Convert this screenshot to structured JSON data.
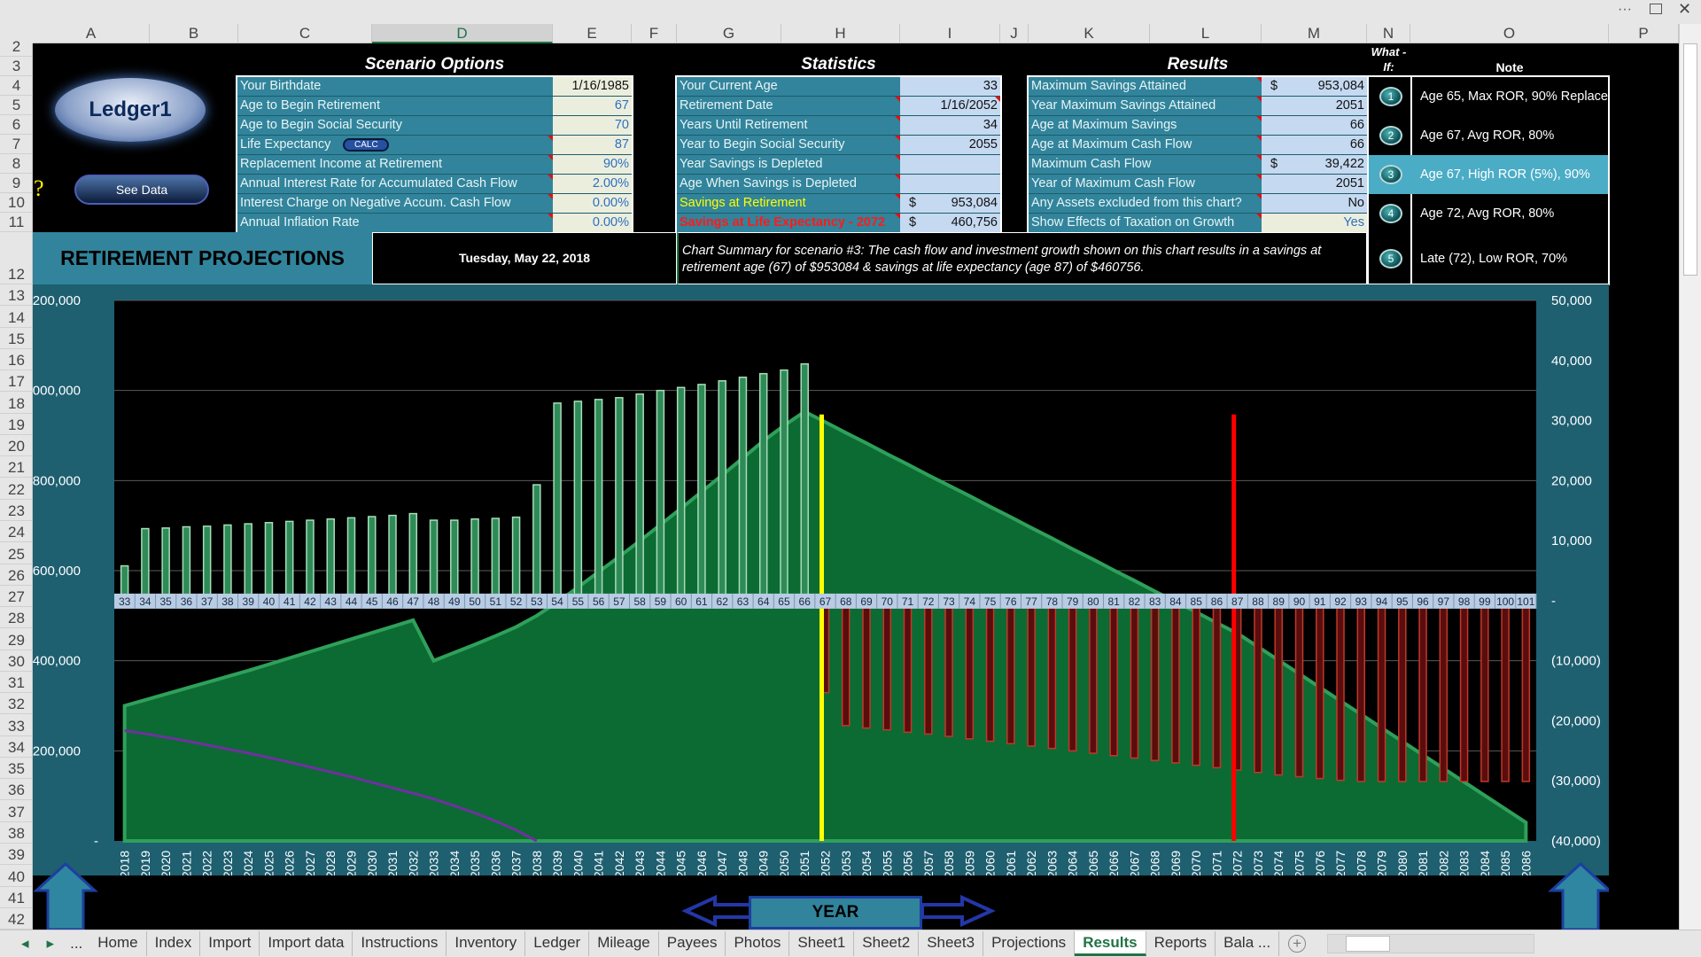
{
  "window": {
    "more_label": "···",
    "restore_icon": "restore-icon",
    "close_icon": "close-icon"
  },
  "columns": [
    "A",
    "B",
    "C",
    "D",
    "E",
    "F",
    "G",
    "H",
    "I",
    "J",
    "K",
    "L",
    "M",
    "N",
    "O",
    "P"
  ],
  "selected_column": "D",
  "rows": [
    "2",
    "3",
    "4",
    "5",
    "6",
    "7",
    "8",
    "9",
    "10",
    "11",
    "12",
    "13",
    "14",
    "15",
    "16",
    "17",
    "18",
    "19",
    "20",
    "21",
    "22",
    "23",
    "24",
    "25",
    "26",
    "27",
    "28",
    "29",
    "30",
    "31",
    "32",
    "33",
    "34",
    "35",
    "36",
    "37",
    "38",
    "39",
    "40",
    "41",
    "42"
  ],
  "logo": {
    "label": "Ledger1"
  },
  "see_data_button": "See Data",
  "help_icon": "?",
  "scenario": {
    "title": "Scenario Options",
    "calc_button": "CALC",
    "items": [
      {
        "label": "Your Birthdate",
        "value": "1/16/1985"
      },
      {
        "label": "Age to Begin Retirement",
        "value": "67"
      },
      {
        "label": "Age to Begin Social Security",
        "value": "70"
      },
      {
        "label": "Life Expectancy",
        "value": "87"
      },
      {
        "label": "Replacement Income at Retirement",
        "value": "90%"
      },
      {
        "label": "Annual Interest Rate for Accumulated Cash Flow",
        "value": "2.00%"
      },
      {
        "label": "Interest Charge on Negative Accum. Cash Flow",
        "value": "0.00%"
      },
      {
        "label": "Annual Inflation Rate",
        "value": "0.00%"
      }
    ]
  },
  "statistics": {
    "title": "Statistics",
    "items": [
      {
        "label": "Your Current Age",
        "currency": "",
        "value": "33"
      },
      {
        "label": "Retirement Date",
        "currency": "",
        "value": "1/16/2052"
      },
      {
        "label": "Years Until Retirement",
        "currency": "",
        "value": "34"
      },
      {
        "label": "Year to Begin Social Security",
        "currency": "",
        "value": "2055"
      },
      {
        "label": "Year Savings is Depleted",
        "currency": "",
        "value": ""
      },
      {
        "label": "Age When Savings is Depleted",
        "currency": "",
        "value": ""
      },
      {
        "label": "Savings at Retirement",
        "currency": "$",
        "value": "953,084",
        "color": "#ffff00"
      },
      {
        "label": "Savings at Life Expectancy - 2072",
        "currency": "$",
        "value": "460,756",
        "color": "#ff1a1a"
      }
    ]
  },
  "results": {
    "title": "Results",
    "items": [
      {
        "label": "Maximum Savings Attained",
        "currency": "$",
        "value": "953,084"
      },
      {
        "label": "Year Maximum Savings Attained",
        "currency": "",
        "value": "2051"
      },
      {
        "label": "Age at Maximum Savings",
        "currency": "",
        "value": "66"
      },
      {
        "label": "Age at Maximum Cash Flow",
        "currency": "",
        "value": "66"
      },
      {
        "label": "Maximum Cash Flow",
        "currency": "$",
        "value": "39,422"
      },
      {
        "label": "Year of Maximum Cash Flow",
        "currency": "",
        "value": "2051"
      },
      {
        "label": "Any Assets excluded from this chart?",
        "currency": "",
        "value": "No"
      },
      {
        "label": "Show Effects of Taxation on Growth",
        "currency": "",
        "value": "Yes"
      }
    ]
  },
  "whatif": {
    "header": "What - If:",
    "note_header": "Note",
    "selected": 3,
    "selected_color": "#4bacc6",
    "items": [
      {
        "num": "1",
        "note": "Age 65, Max ROR, 90% Replace"
      },
      {
        "num": "2",
        "note": "Age 67, Avg ROR, 80%"
      },
      {
        "num": "3",
        "note": "Age 67, High ROR (5%), 90%"
      },
      {
        "num": "4",
        "note": "Age 72, Avg ROR,  80%"
      },
      {
        "num": "5",
        "note": "Late (72), Low ROR, 70%"
      }
    ]
  },
  "banner": {
    "title": "RETIREMENT PROJECTIONS",
    "date": "Tuesday, May 22, 2018",
    "summary": "Chart Summary for scenario #3:  The cash flow and investment growth shown on this chart results in a savings at retirement age (67) of $953084 & savings at life expectancy (age  87) of $460756."
  },
  "year_button": "YEAR",
  "chart_data": {
    "type": "combo",
    "years": [
      2018,
      2019,
      2020,
      2021,
      2022,
      2023,
      2024,
      2025,
      2026,
      2027,
      2028,
      2029,
      2030,
      2031,
      2032,
      2033,
      2034,
      2035,
      2036,
      2037,
      2038,
      2039,
      2040,
      2041,
      2042,
      2043,
      2044,
      2045,
      2046,
      2047,
      2048,
      2049,
      2050,
      2051,
      2052,
      2053,
      2054,
      2055,
      2056,
      2057,
      2058,
      2059,
      2060,
      2061,
      2062,
      2063,
      2064,
      2065,
      2066,
      2067,
      2068,
      2069,
      2070,
      2071,
      2072,
      2073,
      2074,
      2075,
      2076,
      2077,
      2078,
      2079,
      2080,
      2081,
      2082,
      2083,
      2084,
      2085,
      2086
    ],
    "ages": [
      33,
      34,
      35,
      36,
      37,
      38,
      39,
      40,
      41,
      42,
      43,
      44,
      45,
      46,
      47,
      48,
      49,
      50,
      51,
      52,
      53,
      54,
      55,
      56,
      57,
      58,
      59,
      60,
      61,
      62,
      63,
      64,
      65,
      66,
      67,
      68,
      69,
      70,
      71,
      72,
      73,
      74,
      75,
      76,
      77,
      78,
      79,
      80,
      81,
      82,
      83,
      84,
      85,
      86,
      87,
      88,
      89,
      90,
      91,
      92,
      93,
      94,
      95,
      96,
      97,
      98,
      99,
      100,
      101
    ],
    "left_axis": {
      "min": 0,
      "max": 1200000,
      "ticks": [
        "-",
        "200,000",
        "400,000",
        "600,000",
        "800,000",
        "1,000,000",
        "1,200,000"
      ],
      "grid": true
    },
    "right_axis": {
      "min": -40000,
      "max": 50000,
      "ticks": [
        "(40,000)",
        "(30,000)",
        "(20,000)",
        "(10,000)",
        "-",
        "10,000",
        "20,000",
        "30,000",
        "40,000",
        "50,000"
      ]
    },
    "savings_area": {
      "axis": "left",
      "type": "area",
      "color": "#0b6b33",
      "values": [
        300000,
        313000,
        326000,
        339000,
        352000,
        365000,
        378000,
        392000,
        406000,
        420000,
        434000,
        448000,
        462000,
        476000,
        490000,
        400000,
        418000,
        436000,
        455000,
        475000,
        500000,
        530000,
        563000,
        597000,
        631000,
        666000,
        702000,
        738000,
        775000,
        812000,
        850000,
        888000,
        922000,
        953084,
        930000,
        906000,
        883000,
        859000,
        836000,
        812000,
        789000,
        766000,
        742000,
        719000,
        695000,
        672000,
        648000,
        625000,
        601000,
        578000,
        554000,
        531000,
        508000,
        484000,
        460756,
        431000,
        401000,
        371000,
        341000,
        311000,
        281000,
        251000,
        221000,
        191000,
        161000,
        131000,
        101000,
        71000,
        41000
      ]
    },
    "cash_flow_bars": {
      "axis": "right",
      "type": "bar",
      "positive_color": "#2e8b57",
      "negative_color": "#5a0d0d",
      "values": [
        5800,
        12000,
        12100,
        12300,
        12400,
        12600,
        12800,
        13000,
        13200,
        13400,
        13600,
        13800,
        14000,
        14200,
        14500,
        13400,
        13400,
        13600,
        13700,
        13900,
        19300,
        32900,
        33200,
        33500,
        33800,
        34400,
        35000,
        35500,
        36000,
        36600,
        37200,
        37800,
        38400,
        39422,
        -15300,
        -20800,
        -21200,
        -21500,
        -21900,
        -22200,
        -22600,
        -23000,
        -23400,
        -23800,
        -24200,
        -24600,
        -25000,
        -25400,
        -25800,
        -26200,
        -26600,
        -27000,
        -27400,
        -27800,
        -28200,
        -28600,
        -29000,
        -29300,
        -29600,
        -29900,
        -30100,
        -30100,
        -30100,
        -30100,
        -30100,
        -30100,
        -30100,
        -30100,
        -30100
      ]
    },
    "purple_line": {
      "axis": "left",
      "type": "line",
      "color": "#7030a0",
      "values": [
        245000,
        238000,
        230000,
        222000,
        213000,
        204000,
        195000,
        185000,
        175000,
        164000,
        153000,
        142000,
        130000,
        118000,
        106000,
        93000,
        78000,
        62000,
        44000,
        24000,
        0
      ]
    },
    "markers": [
      {
        "year": 2052,
        "color": "#ffff00"
      },
      {
        "year": 2072,
        "color": "#ff0000"
      }
    ],
    "marker_top_right_axis": 31000
  },
  "sheet_tabs": [
    "Home",
    "Index",
    "Import",
    "Import data",
    "Instructions",
    "Inventory",
    "Ledger",
    "Mileage",
    "Payees",
    "Photos",
    "Sheet1",
    "Sheet2",
    "Sheet3",
    "Projections",
    "Results",
    "Reports",
    "Bala ..."
  ],
  "active_tab": "Results"
}
